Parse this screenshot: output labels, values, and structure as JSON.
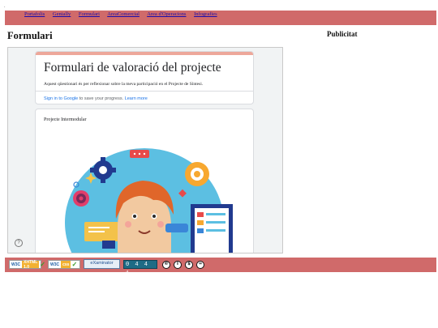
{
  "dot": ".",
  "nav": {
    "links": [
      "Portafolis",
      "Genially",
      "Formulari",
      "AreaComercial",
      "Area d'Operacions",
      "Infografies"
    ]
  },
  "page_title": "Formulari",
  "ads_title": "Publicitat",
  "form": {
    "title": "Formulari de valoració del projecte",
    "description": "Aquest qüestionari és per reflexionar sobre la meva participació en el Projecte de Síntesi.",
    "signin_link": "Sign in to Google",
    "signin_text": " to save your progress. ",
    "learn_more": "Learn more",
    "question_title": "Projecte Intermodular",
    "help": "?"
  },
  "footer": {
    "w3c_html": {
      "w3c": "W3C",
      "tag": "XHTML 1.0"
    },
    "w3c_css": {
      "w3c": "W3C",
      "tag": "css"
    },
    "examinator": {
      "name": "eXaminator",
      "sub": "accessibilitat web: puntuació"
    },
    "counter": "0 4 4 1",
    "cc_icons": [
      "cc",
      "by",
      "nc",
      "nd"
    ]
  },
  "colors": {
    "nav_bg": "#d06a6a",
    "accent": "#eda79a",
    "link": "#1a0dab"
  }
}
